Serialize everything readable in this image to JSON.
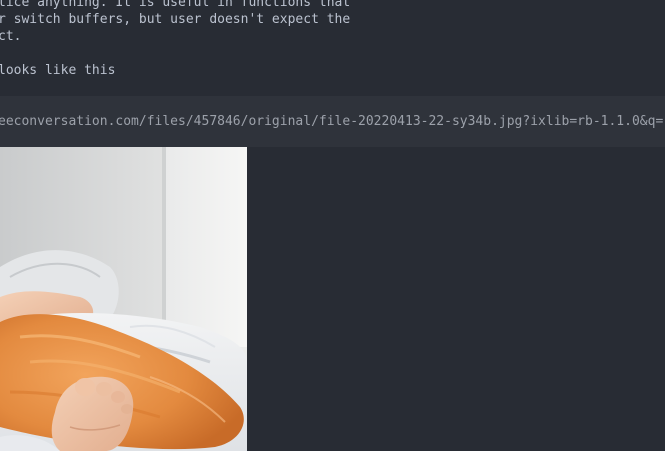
{
  "text_lines": [
    "tice anything. It is useful in functions that",
    "r switch buffers, but user doesn't expect the",
    "ct.",
    "looks like this"
  ],
  "url": "eeconversation.com/files/457846/original/file-20220413-22-sy34b.jpg?ixlib=rb-1.1.0&q=",
  "colors": {
    "background": "#282c34",
    "text": "#bbc2cf",
    "url_block": "#2f333b",
    "url_text": "#9ca1aa"
  },
  "image": {
    "subject": "ginger cat lying across a person's feet on white bed sheets"
  }
}
